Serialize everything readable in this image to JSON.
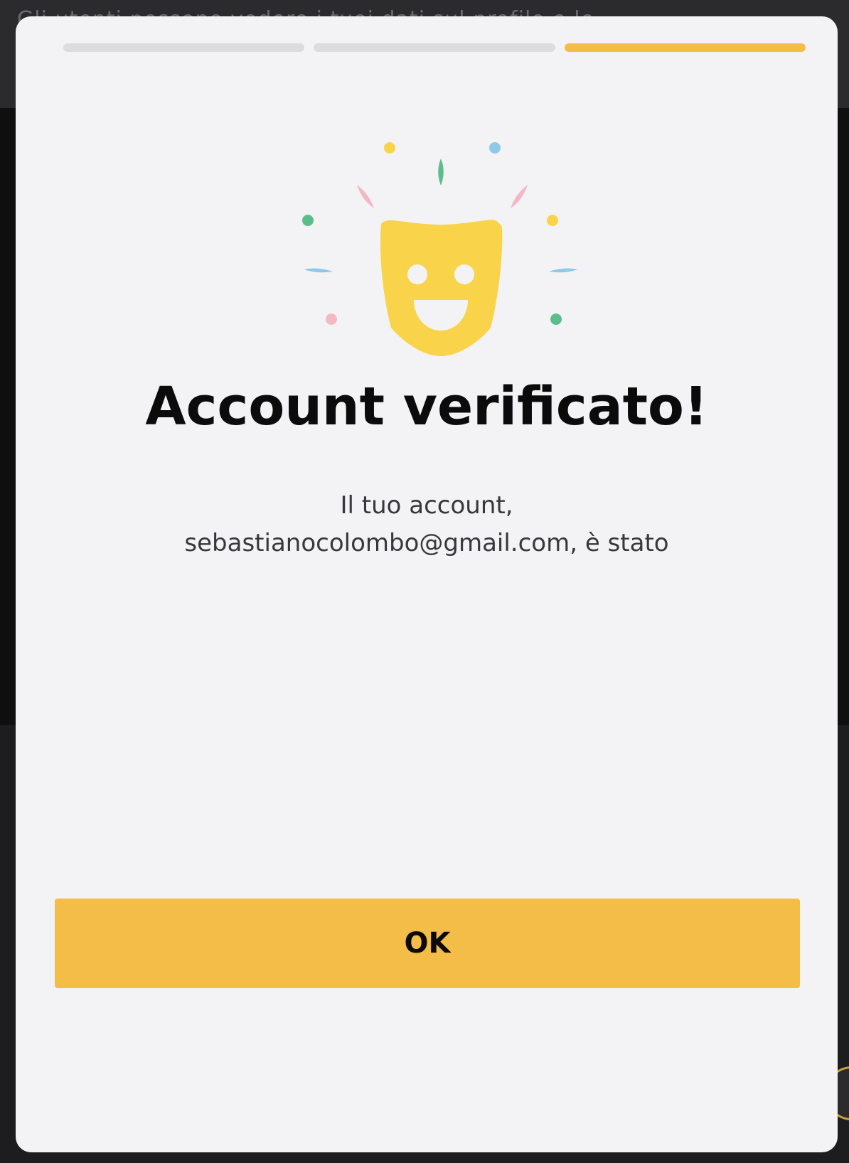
{
  "background": {
    "header_text": "Gli utenti possono vedere i tuoi dati sul profilo e le"
  },
  "progress": {
    "steps": 3,
    "current_step": 3,
    "active_color": "#F3BD48",
    "inactive_color": "#DCDCDF"
  },
  "illustration": {
    "icon": "smiling-mask-icon",
    "mask_color": "#F9D44A",
    "confetti_colors": [
      "#F9D44A",
      "#8EC9E8",
      "#5BBE8A",
      "#F2B9C4"
    ]
  },
  "modal": {
    "title": "Account verificato!",
    "message_line1": "Il tuo account,",
    "message_line2": "sebastianocolombo@gmail.com, è stato",
    "ok_label": "OK"
  }
}
